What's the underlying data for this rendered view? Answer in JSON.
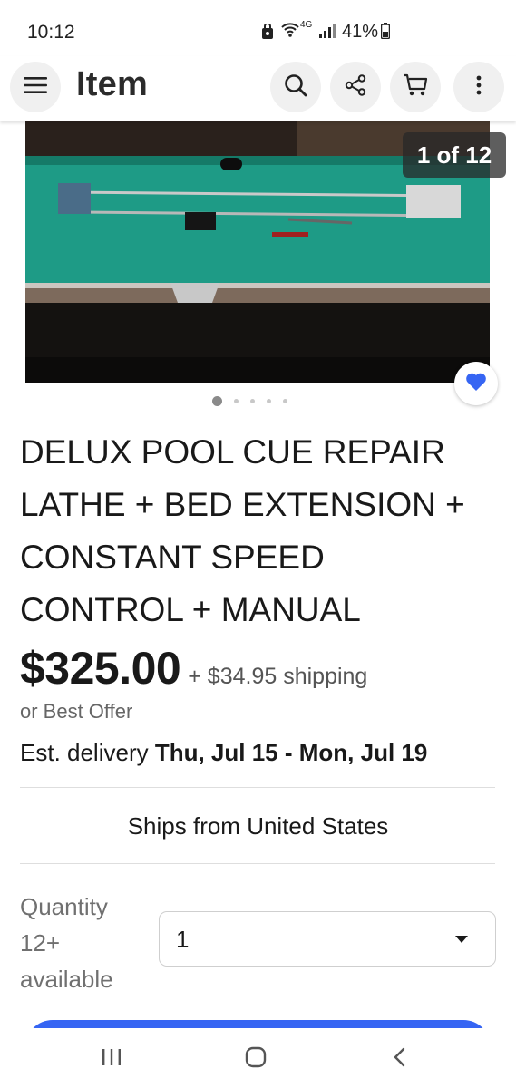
{
  "status_bar": {
    "time": "10:12",
    "network": "4G",
    "battery": "41%"
  },
  "app_bar": {
    "title": "Item",
    "icons": [
      "menu-icon",
      "search-icon",
      "share-icon",
      "cart-icon",
      "more-vertical-icon"
    ]
  },
  "gallery": {
    "counter": "1 of 12",
    "total_dots": 5,
    "active_dot": 0,
    "favorite_color": "#3665f3"
  },
  "listing": {
    "title": "DELUX POOL CUE REPAIR LATHE + BED EXTENSION + CONSTANT SPEED CONTROL + MANUAL",
    "price": "$325.00",
    "shipping": "+ $34.95 shipping",
    "best_offer": "or Best Offer",
    "delivery_prefix": "Est. delivery ",
    "delivery_dates": "Thu, Jul 15 - Mon, Jul 19",
    "ships_from": "Ships from United States"
  },
  "quantity": {
    "label": "Quantity 12+ available",
    "value": "1"
  },
  "colors": {
    "accent": "#3665f3",
    "text": "#191919",
    "muted": "#707070"
  }
}
